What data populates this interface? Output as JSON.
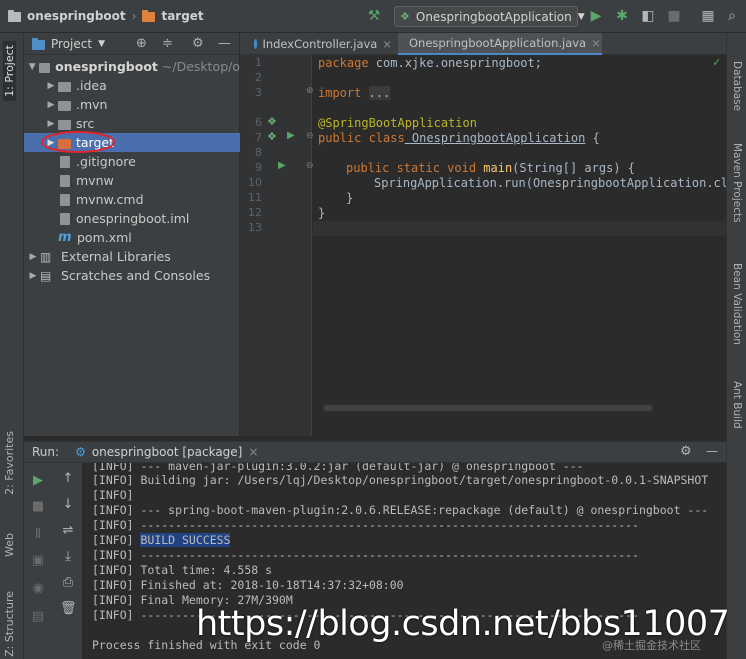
{
  "topbar": {
    "project": "onespringboot",
    "folder": "target",
    "run_config": "OnespringbootApplication"
  },
  "left_tabs": [
    "1: Project",
    "2: Favorites",
    "Web",
    "Z: Structure"
  ],
  "right_tabs": [
    "Database",
    "Maven Projects",
    "Bean Validation",
    "Ant Build"
  ],
  "project_panel": {
    "title": "Project",
    "root": {
      "name": "onespringboot",
      "path": "~/Desktop/o"
    },
    "items": [
      {
        "label": "idea",
        "display": ".idea"
      },
      {
        "label": "mvn",
        "display": ".mvn"
      },
      {
        "label": "src",
        "display": "src"
      },
      {
        "label": "target",
        "display": "target"
      },
      {
        "label": "gitignore",
        "display": ".gitignore"
      },
      {
        "label": "mvnw",
        "display": "mvnw"
      },
      {
        "label": "mvnw.cmd",
        "display": "mvnw.cmd"
      },
      {
        "label": "iml",
        "display": "onespringboot.iml"
      },
      {
        "label": "pom",
        "display": "pom.xml"
      },
      {
        "label": "ext",
        "display": "External Libraries"
      },
      {
        "label": "scratch",
        "display": "Scratches and Consoles"
      }
    ]
  },
  "editor": {
    "tabs": [
      "IndexController.java",
      "OnespringbootApplication.java"
    ],
    "line_numbers": [
      "1",
      "2",
      "3",
      "6",
      "7",
      "8",
      "9",
      "10",
      "11",
      "12",
      "13"
    ],
    "code": {
      "l1_kw": "package",
      "l1_rest": " com.xjke.onespringboot;",
      "l3_kw": "import",
      "l3_fold": "...",
      "l6": "@SpringBootApplication",
      "l7_kw": "public class",
      "l7_name": " OnespringbootApplication",
      "l7_rest": " {",
      "l9_kw": "public static void",
      "l9_fn": " main",
      "l9_rest": "(String[] args) {",
      "l10": "SpringApplication.run(OnespringbootApplication.cla",
      "l11": "}",
      "l12": "}"
    }
  },
  "run_panel": {
    "label": "Run:",
    "tab": "onespringboot [package]",
    "console": [
      "[INFO] --- maven-jar-plugin:3.0.2:jar (default-jar) @ onespringboot ---",
      "[INFO] Building jar: /Users/lqj/Desktop/onespringboot/target/onespringboot-0.0.1-SNAPSHOT",
      "[INFO]",
      "[INFO] --- spring-boot-maven-plugin:2.0.6.RELEASE:repackage (default) @ onespringboot ---",
      "[INFO] ------------------------------------------------------------------------",
      "[INFO] ",
      "[INFO] ------------------------------------------------------------------------",
      "[INFO] Total time: 4.558 s",
      "[INFO] Finished at: 2018-10-18T14:37:32+08:00",
      "[INFO] Final Memory: 27M/390M",
      "[INFO] ------------------------------------------------------------------------",
      "",
      "Process finished with exit code 0"
    ],
    "build_success": "BUILD SUCCESS"
  },
  "watermark": "https://blog.csdn.net/bbs11007",
  "juejin": "@稀土掘金技术社区"
}
